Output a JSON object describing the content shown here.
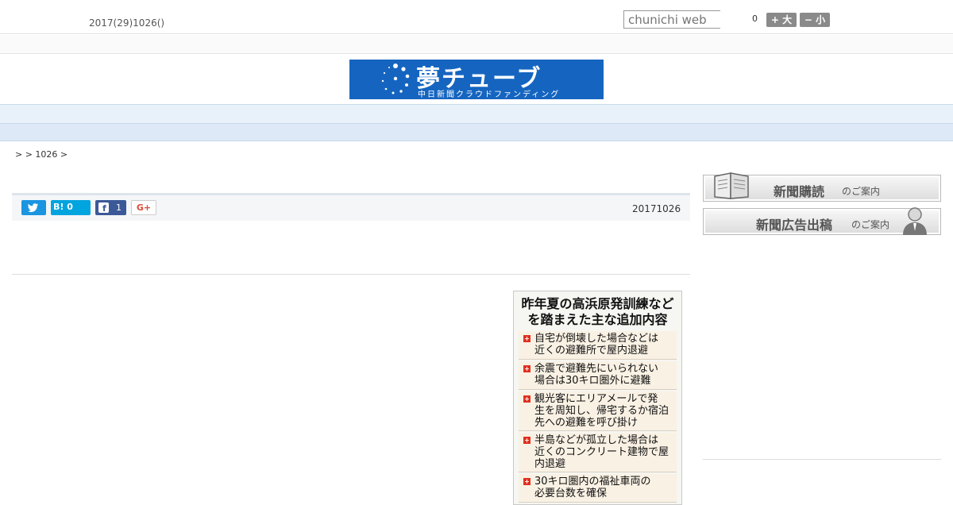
{
  "header": {
    "date_text": "2017(29)1026()",
    "search_placeholder": "chunichi web",
    "font_size_value": "0",
    "font_large_label": "+ 大",
    "font_small_label": "− 小"
  },
  "banner": {
    "title": "夢チューブ",
    "subtitle": "中日新聞クラウドファンディング"
  },
  "nav": {
    "items": [
      "",
      "",
      "",
      "",
      "",
      "",
      "",
      "",
      ""
    ]
  },
  "breadcrumb": {
    "text": ">  > 1026 >"
  },
  "share": {
    "hatena_label": "B! 0",
    "facebook_count": "1",
    "google_label": "G+"
  },
  "article": {
    "published_date": "20171026"
  },
  "infobox": {
    "title_line1": "昨年夏の高浜原発訓練など",
    "title_line2": "を踏まえた主な追加内容",
    "items": [
      {
        "l1": "自宅が倒壊した場合などは",
        "l2": "近くの避難所で屋内退避",
        "l3": ""
      },
      {
        "l1": "余震で避難先にいられない",
        "l2": "場合は30キロ圏外に避難",
        "l3": ""
      },
      {
        "l1": "観光客にエリアメールで発",
        "l2": "生を周知し、帰宅するか宿泊",
        "l3": "先への避難を呼び掛け"
      },
      {
        "l1": "半島などが孤立した場合は",
        "l2": "近くのコンクリート建物で屋",
        "l3": "内退避"
      },
      {
        "l1": "30キロ圏内の福祉車両の",
        "l2": "必要台数を確保",
        "l3": ""
      }
    ]
  },
  "sidebar": {
    "subscribe_main": "新聞購読",
    "subscribe_small": "のご案内",
    "ad_main": "新聞広告出稿",
    "ad_small": "のご案内"
  },
  "colors": {
    "banner_blue": "#1565c0",
    "nav_bg": "#e8f0fa",
    "twitter": "#1b95e0",
    "hatena": "#00a4de",
    "facebook": "#3b5998"
  }
}
